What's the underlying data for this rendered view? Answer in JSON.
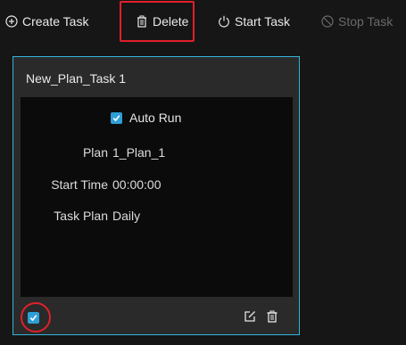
{
  "toolbar": {
    "create_label": "Create Task",
    "delete_label": "Delete",
    "start_label": "Start Task",
    "stop_label": "Stop Task",
    "icons": {
      "create": "plus-circle-icon",
      "delete": "trash-icon",
      "start": "power-icon",
      "stop": "ban-icon"
    }
  },
  "task_card": {
    "title": "New_Plan_Task 1",
    "auto_run_label": "Auto Run",
    "auto_run_checked": true,
    "fields": [
      {
        "label": "Plan",
        "value": "1_Plan_1"
      },
      {
        "label": "Start Time",
        "value": "00:00:00"
      },
      {
        "label": "Task Plan",
        "value": "Daily"
      }
    ],
    "selected": true,
    "footer_icons": {
      "edit": "edit-icon",
      "delete": "trash-icon"
    }
  },
  "colors": {
    "accent": "#2f9ed6",
    "card_border": "#33b3d8",
    "highlight": "#e0202a",
    "disabled_text": "#6a6a6a"
  }
}
